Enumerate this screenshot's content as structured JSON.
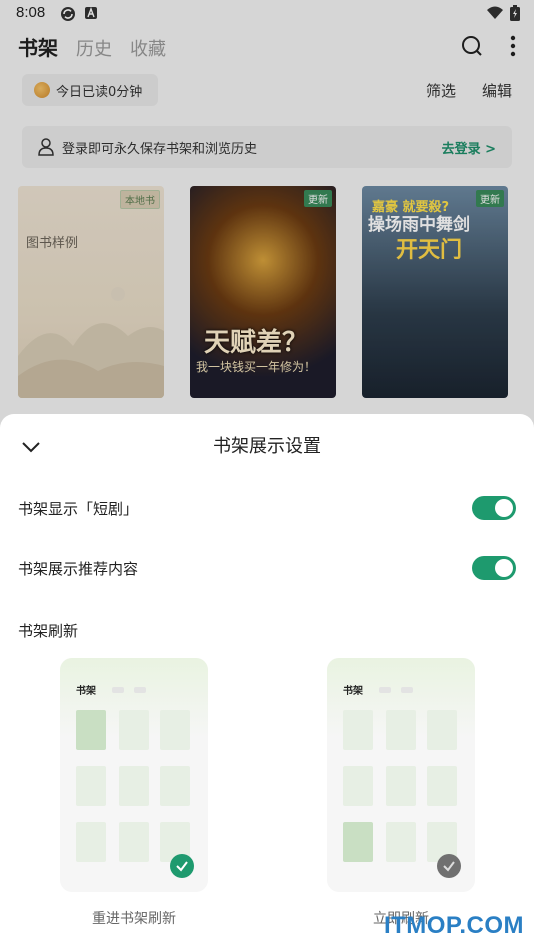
{
  "status_bar": {
    "time": "8:08"
  },
  "top_tabs": [
    {
      "label": "书架",
      "active": true
    },
    {
      "label": "历史",
      "active": false
    },
    {
      "label": "收藏",
      "active": false
    }
  ],
  "read_chip": {
    "text": "今日已读0分钟"
  },
  "shelf_actions": {
    "filter": "筛选",
    "edit": "编辑"
  },
  "login_bar": {
    "text": "登录即可永久保存书架和浏览历史",
    "link": "去登录 >"
  },
  "books": [
    {
      "badge": "本地书",
      "title": "图书样例"
    },
    {
      "badge": "更新",
      "title": "天赋差？",
      "subtitle": "我一块钱买一年修为！"
    },
    {
      "badge": "更新",
      "title_top": "嘉豪 就要殺?",
      "title_mid": "操场雨中舞剑",
      "title_bottom": "开天门"
    }
  ],
  "sheet": {
    "title": "书架展示设置",
    "options": [
      {
        "label": "书架显示「短剧」",
        "enabled": true
      },
      {
        "label": "书架展示推荐内容",
        "enabled": true
      }
    ],
    "refresh_section": "书架刷新",
    "refresh_choices": [
      {
        "mini_title": "书架",
        "label": "重进书架刷新",
        "selected": true
      },
      {
        "mini_title": "书架",
        "label": "立即刷新",
        "selected": false
      }
    ]
  },
  "watermark": "ITMOP.COM",
  "colors": {
    "accent": "#1e9a6e",
    "link": "#1e8f6a",
    "watermark": "#2a7fc4"
  }
}
